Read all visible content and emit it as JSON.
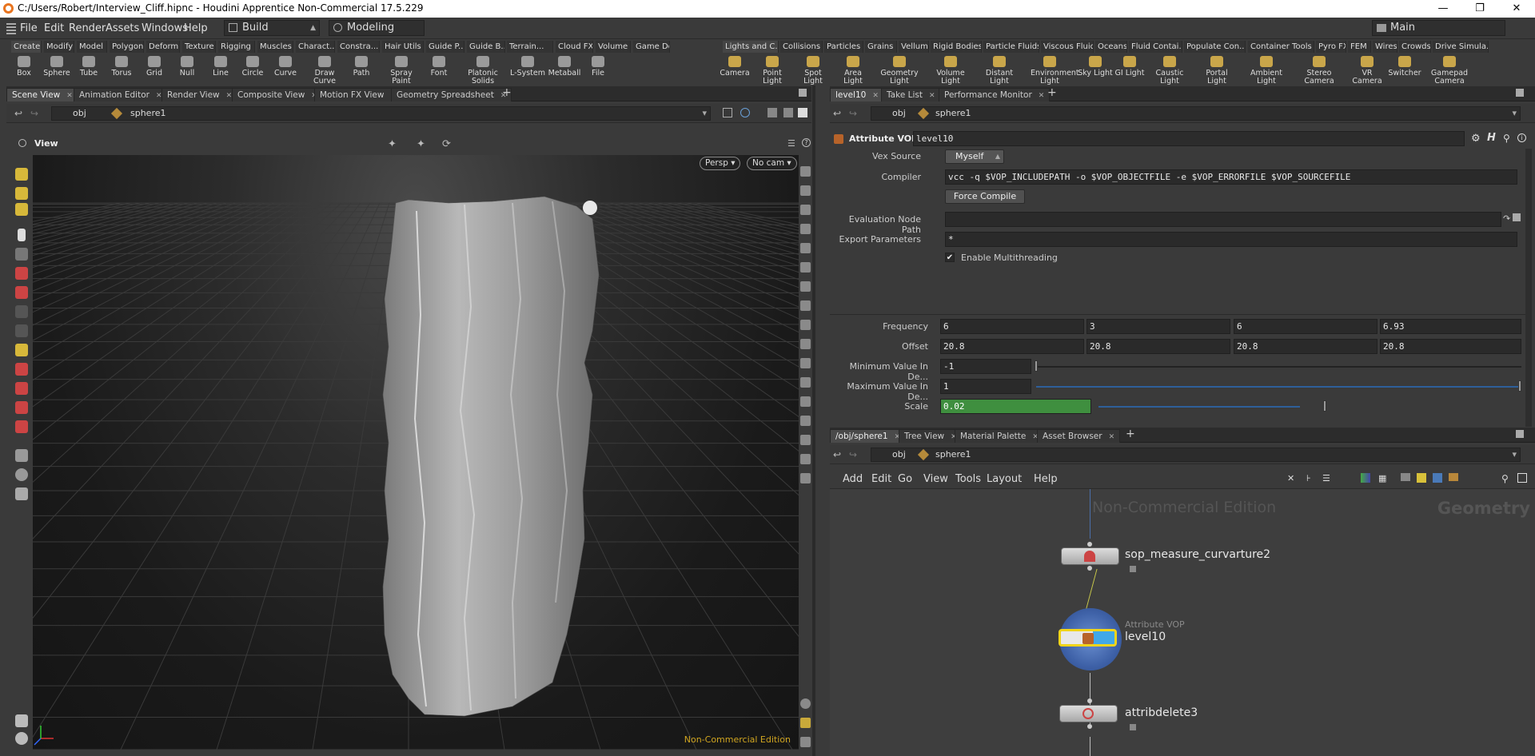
{
  "window": {
    "title": "C:/Users/Robert/Interview_Cliff.hipnc - Houdini Apprentice Non-Commercial 17.5.229",
    "minimize": "—",
    "restore": "❐",
    "close": "✕"
  },
  "menubar": {
    "items": [
      "File",
      "Edit",
      "Render",
      "Assets",
      "Windows",
      "Help"
    ],
    "desktop": "Build",
    "context": "Modeling",
    "desktop_right": "Main"
  },
  "shelf_left": {
    "tabs": [
      "Create",
      "Modify",
      "Model",
      "Polygon",
      "Deform",
      "Texture",
      "Rigging",
      "Muscles",
      "Charact...",
      "Constra...",
      "Hair Utils",
      "Guide P...",
      "Guide B...",
      "Terrain...",
      "Cloud FX",
      "Volume",
      "Game De..."
    ],
    "tools": [
      "Box",
      "Sphere",
      "Tube",
      "Torus",
      "Grid",
      "Null",
      "Line",
      "Circle",
      "Curve",
      "Draw Curve",
      "Path",
      "Spray Paint",
      "Font",
      "Platonic Solids",
      "L-System",
      "Metaball",
      "File"
    ]
  },
  "shelf_right": {
    "tabs": [
      "Lights and C...",
      "Collisions",
      "Particles",
      "Grains",
      "Vellum",
      "Rigid Bodies",
      "Particle Fluids",
      "Viscous Fluids",
      "Oceans",
      "Fluid Contai...",
      "Populate Con...",
      "Container Tools",
      "Pyro FX",
      "FEM",
      "Wires",
      "Crowds",
      "Drive Simula..."
    ],
    "tools": [
      "Camera",
      "Point Light",
      "Spot Light",
      "Area Light",
      "Geometry Light",
      "Volume Light",
      "Distant Light",
      "Environment Light",
      "Sky Light",
      "GI Light",
      "Caustic Light",
      "Portal Light",
      "Ambient Light",
      "Stereo Camera",
      "VR Camera",
      "Switcher",
      "Gamepad Camera"
    ]
  },
  "left_pane": {
    "tabs": [
      "Scene View",
      "Animation Editor",
      "Render View",
      "Composite View",
      "Motion FX View",
      "Geometry Spreadsheet"
    ],
    "path": [
      "obj",
      "sphere1"
    ],
    "view_label": "View",
    "persp": "Persp ▾",
    "cam": "No cam ▾",
    "watermark": "Non-Commercial Edition"
  },
  "param_pane": {
    "tabs": [
      "level10",
      "Take List",
      "Performance Monitor"
    ],
    "path": [
      "obj",
      "sphere1"
    ],
    "node_type": "Attribute VOP",
    "node_name": "level10",
    "vex_source_label": "Vex Source",
    "vex_source": "Myself",
    "compiler_label": "Compiler",
    "compiler": "vcc -q $VOP_INCLUDEPATH -o $VOP_OBJECTFILE -e $VOP_ERRORFILE $VOP_SOURCEFILE",
    "force_compile": "Force Compile",
    "eval_path_label": "Evaluation Node Path",
    "eval_path": "",
    "export_label": "Export Parameters",
    "export": "*",
    "multithread": "Enable Multithreading",
    "frequency_label": "Frequency",
    "frequency": [
      "6",
      "3",
      "6",
      "6.93"
    ],
    "offset_label": "Offset",
    "offset": [
      "20.8",
      "20.8",
      "20.8",
      "20.8"
    ],
    "min_label": "Minimum Value In De...",
    "min": "-1",
    "max_label": "Maximum Value In De...",
    "max": "1",
    "scale_label": "Scale",
    "scale": "0.02"
  },
  "net_pane": {
    "tabs": [
      "/obj/sphere1",
      "Tree View",
      "Material Palette",
      "Asset Browser"
    ],
    "path": [
      "obj",
      "sphere1"
    ],
    "menu": [
      "Add",
      "Edit",
      "Go",
      "View",
      "Tools",
      "Layout",
      "Help"
    ],
    "watermark": "Non-Commercial Edition",
    "context": "Geometry",
    "nodes": [
      {
        "name": "sop_measure_curvarture2",
        "type": ""
      },
      {
        "name": "level10",
        "type": "Attribute VOP"
      },
      {
        "name": "attribdelete3",
        "type": ""
      }
    ]
  }
}
